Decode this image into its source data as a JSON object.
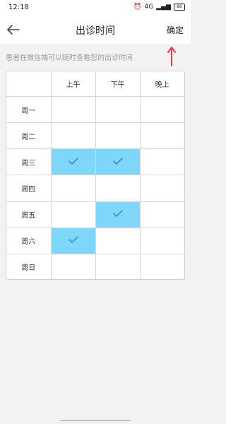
{
  "status_bar": {
    "time": "12:18",
    "network_text": "4G",
    "battery_level": "86"
  },
  "nav": {
    "title": "出诊时间",
    "confirm_label": "确定"
  },
  "hint": "患者在微信端可以随时查看您的出诊时间",
  "schedule": {
    "columns": [
      "上午",
      "下午",
      "晚上"
    ],
    "rows": [
      {
        "day": "周一",
        "slots": [
          false,
          false,
          false
        ]
      },
      {
        "day": "周二",
        "slots": [
          false,
          false,
          false
        ]
      },
      {
        "day": "周三",
        "slots": [
          true,
          true,
          false
        ]
      },
      {
        "day": "周四",
        "slots": [
          false,
          false,
          false
        ]
      },
      {
        "day": "周五",
        "slots": [
          false,
          true,
          false
        ]
      },
      {
        "day": "周六",
        "slots": [
          true,
          false,
          false
        ]
      },
      {
        "day": "周日",
        "slots": [
          false,
          false,
          false
        ]
      }
    ],
    "selected_color": "#7fd6fb",
    "check_color": "#2a7fc1"
  },
  "annotation_color": "#e0404a"
}
